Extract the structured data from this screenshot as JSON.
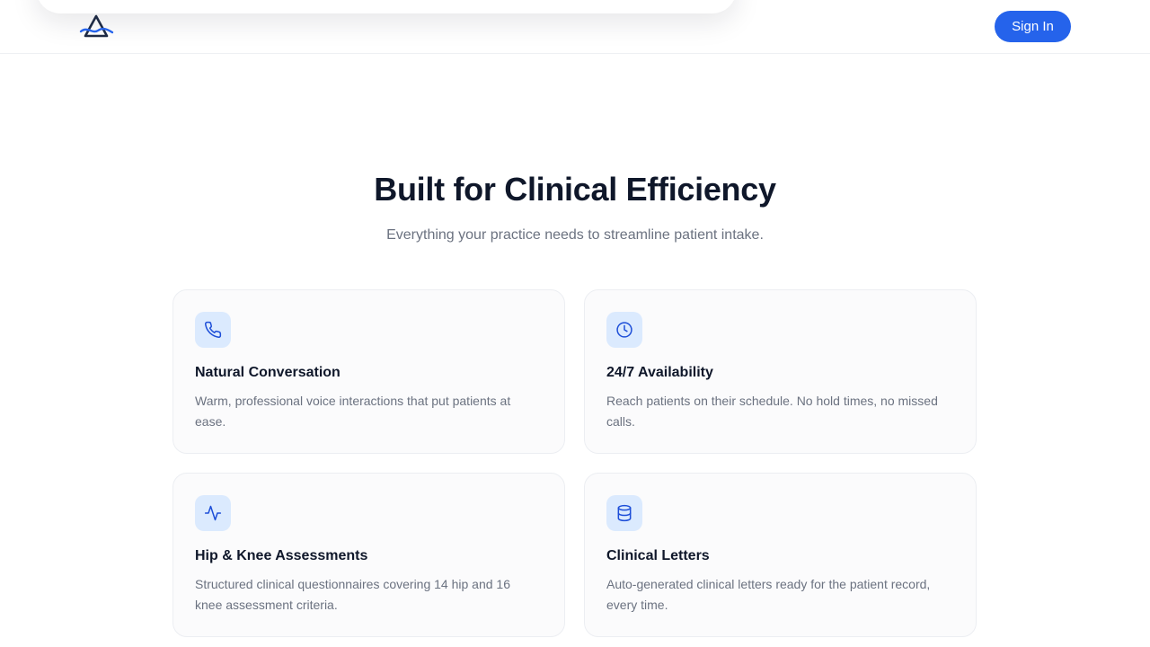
{
  "header": {
    "logo_icon": "triangle-logo-icon",
    "signin_label": "Sign In",
    "accent": "#2563eb"
  },
  "main": {
    "title": "Built for Clinical Efficiency",
    "subtitle": "Everything your practice needs to streamline patient intake."
  },
  "features": [
    {
      "icon": "phone-icon",
      "title": "Natural Conversation",
      "description": "Warm, professional voice interactions that put patients at ease."
    },
    {
      "icon": "clock-icon",
      "title": "24/7 Availability",
      "description": "Reach patients on their schedule. No hold times, no missed calls."
    },
    {
      "icon": "activity-icon",
      "title": "Hip & Knee Assessments",
      "description": "Structured clinical questionnaires covering 14 hip and 16 knee assessment criteria."
    },
    {
      "icon": "database-icon",
      "title": "Clinical Letters",
      "description": "Auto-generated clinical letters ready for the patient record, every time."
    }
  ]
}
